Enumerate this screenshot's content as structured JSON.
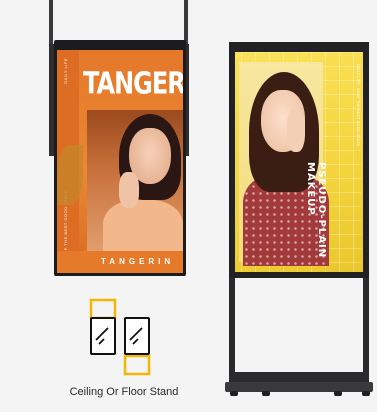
{
  "left_display": {
    "title": "TANGERIN",
    "bottom_text": "TANGERIN",
    "side_text_top": "DAILY LIFE",
    "side_text_bottom": "KEEP THE BEST GOOD STATE",
    "accent_color": "#e6782a"
  },
  "right_display": {
    "title": "PSEUDO-PLAIN\nMAKEUP",
    "side_text": "DAILY LIFE · KEEP THE BEST GOOD STATE",
    "accent_color": "#f4d43c"
  },
  "icon": {
    "name": "ceiling-or-floor-stand-icon",
    "accent_color": "#f2b705"
  },
  "caption": "Ceiling Or Floor Stand"
}
